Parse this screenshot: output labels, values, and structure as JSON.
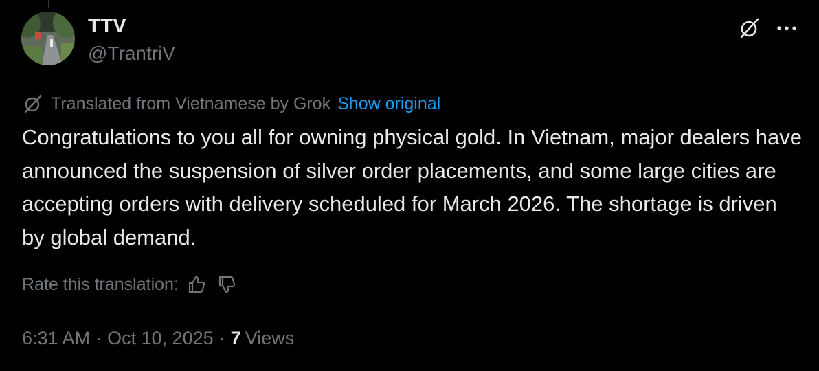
{
  "author": {
    "display_name": "TTV",
    "handle": "@TrantriV"
  },
  "icons": {
    "grok": "grok-icon",
    "more": "more-horizontal-icon",
    "translate": "grok-translate-icon",
    "thumbs_up": "thumbs-up-icon",
    "thumbs_down": "thumbs-down-icon"
  },
  "translation": {
    "notice": "Translated from Vietnamese by Grok",
    "show_original_label": "Show original",
    "rate_label": "Rate this translation:"
  },
  "tweet": {
    "text": "Congratulations to you all for owning physical gold. In Vietnam, major dealers have announced the suspension of silver order placements, and some large cities are accepting orders with delivery scheduled for March 2026. The shortage is driven by global demand.",
    "time": "6:31 AM",
    "separator": "·",
    "date": "Oct 10, 2025",
    "views_count": "7",
    "views_label": "Views"
  },
  "colors": {
    "background": "#000000",
    "primary_text": "#e7e9ea",
    "secondary_text": "#71767b",
    "link": "#1d9bf0"
  }
}
